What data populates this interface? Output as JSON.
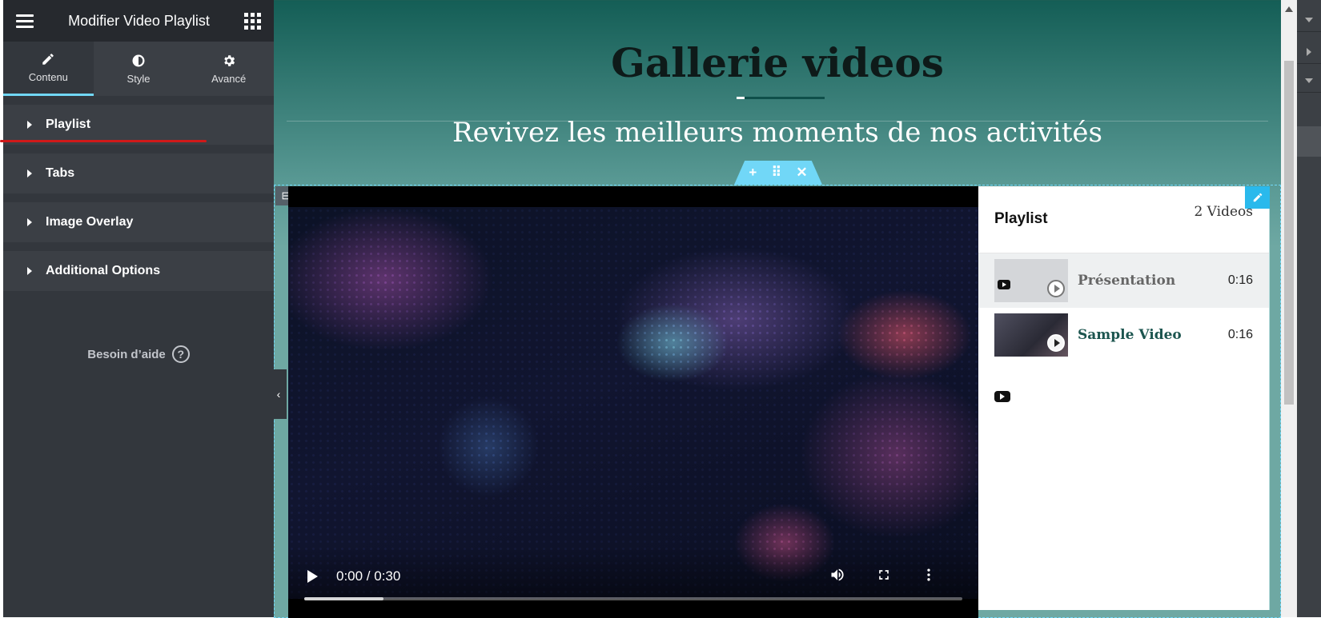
{
  "panel": {
    "title": "Modifier Video Playlist",
    "tabs": [
      {
        "label": "Contenu",
        "icon": "pencil-icon"
      },
      {
        "label": "Style",
        "icon": "contrast-icon"
      },
      {
        "label": "Avancé",
        "icon": "gear-icon"
      }
    ],
    "sections": [
      {
        "label": "Playlist"
      },
      {
        "label": "Tabs"
      },
      {
        "label": "Image Overlay"
      },
      {
        "label": "Additional Options"
      }
    ],
    "help_label": "Besoin d’aide",
    "help_icon": "?"
  },
  "hero": {
    "title": "Gallerie videos",
    "subtitle": "Revivez les meilleurs moments de nos activités"
  },
  "section_handle": {
    "add": "+",
    "move": "⠿",
    "close": "✕"
  },
  "column_handle_icon": "⊟",
  "video": {
    "time": "0:00 / 0:30",
    "progress_fraction": 0.12
  },
  "playlist": {
    "title": "Playlist",
    "count": "2 Videos",
    "items": [
      {
        "title": "Présentation",
        "duration": "0:16"
      },
      {
        "title": "Sample Video",
        "duration": "0:16"
      }
    ]
  },
  "colors": {
    "panel_bg": "#33373d",
    "accent": "#71d7f7",
    "hero_dark": "#145e56",
    "playlist_title_active": "#1c554f"
  }
}
